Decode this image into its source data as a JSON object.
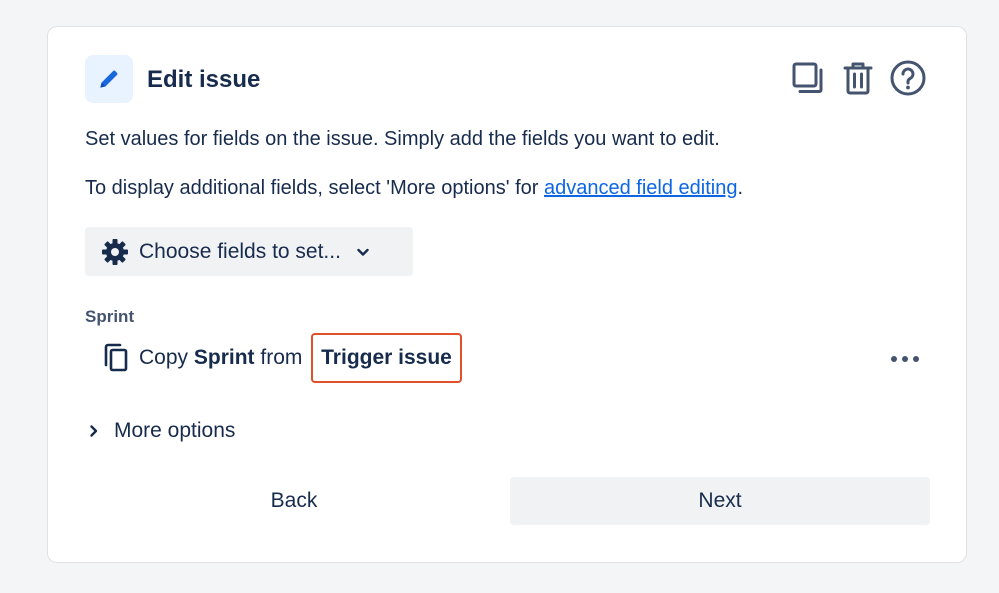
{
  "header": {
    "title": "Edit issue",
    "icons": [
      "pencil-icon",
      "duplicate-icon",
      "trash-icon",
      "help-icon"
    ]
  },
  "description": {
    "line1": "Set values for fields on the issue. Simply add the fields you want to edit.",
    "line2_prefix": "To display additional fields, select 'More options' for ",
    "line2_link": "advanced field editing",
    "line2_suffix": "."
  },
  "choose_fields": {
    "label": "Choose fields to set..."
  },
  "sprint_field": {
    "label": "Sprint",
    "copy_word": "Copy",
    "field_name": "Sprint",
    "from_word": "from",
    "source": "Trigger issue"
  },
  "more_options": {
    "label": "More options"
  },
  "footer": {
    "back_label": "Back",
    "next_label": "Next"
  },
  "colors": {
    "accent": "#0c66e4",
    "highlight_border": "#e0502b",
    "icon_bg": "#e9f2ff"
  }
}
